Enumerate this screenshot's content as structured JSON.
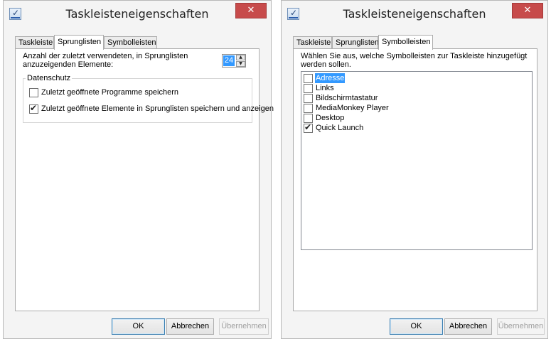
{
  "windows": [
    {
      "title": "Taskleisteneigenschaften",
      "close_symbol": "✕",
      "tabs": [
        "Taskleiste",
        "Sprunglisten",
        "Symbolleisten"
      ],
      "active_tab": "Sprunglisten",
      "recent_items_label_line1": "Anzahl der zuletzt verwendeten, in Sprunglisten",
      "recent_items_label_line2": "anzuzeigenden Elemente:",
      "recent_items_value": "24",
      "privacy_group_label": "Datenschutz",
      "options": [
        {
          "label": "Zuletzt geöffnete Programme speichern",
          "checked": false
        },
        {
          "label": "Zuletzt geöffnete Elemente in Sprunglisten speichern und anzeigen",
          "checked": true
        }
      ],
      "buttons": {
        "ok": "OK",
        "cancel": "Abbrechen",
        "apply": "Übernehmen"
      }
    },
    {
      "title": "Taskleisteneigenschaften",
      "close_symbol": "✕",
      "tabs": [
        "Taskleiste",
        "Sprunglisten",
        "Symbolleisten"
      ],
      "active_tab": "Symbolleisten",
      "description_line1": "Wählen Sie aus, welche Symbolleisten zur Taskleiste hinzugefügt",
      "description_line2": "werden sollen.",
      "toolbars": [
        {
          "label": "Adresse",
          "checked": false,
          "selected": true
        },
        {
          "label": "Links",
          "checked": false,
          "selected": false
        },
        {
          "label": "Bildschirmtastatur",
          "checked": false,
          "selected": false
        },
        {
          "label": "MediaMonkey Player",
          "checked": false,
          "selected": false
        },
        {
          "label": "Desktop",
          "checked": false,
          "selected": false
        },
        {
          "label": "Quick Launch",
          "checked": true,
          "selected": false
        }
      ],
      "buttons": {
        "ok": "OK",
        "cancel": "Abbrechen",
        "apply": "Übernehmen"
      }
    }
  ]
}
